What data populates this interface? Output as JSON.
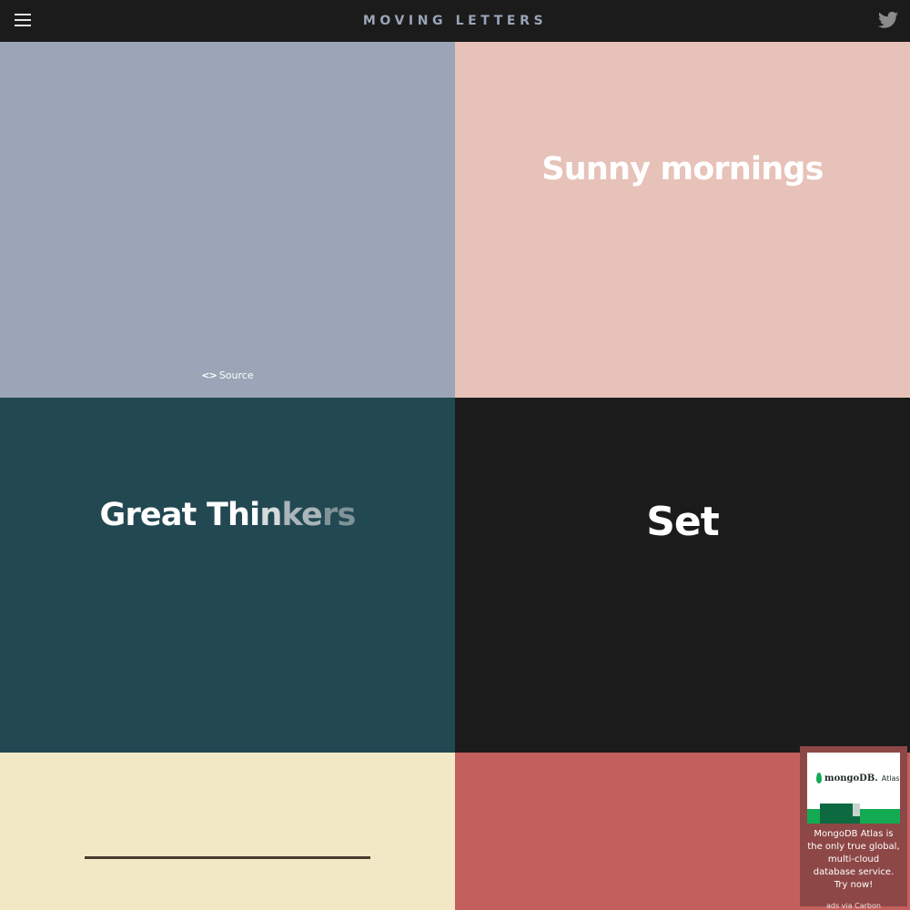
{
  "header": {
    "title": "MOVING LETTERS",
    "menu_icon": "hamburger-icon",
    "social_icon": "twitter-icon"
  },
  "tiles": {
    "source_label": "Source",
    "source_icon": "code-icon",
    "sunny": "Sunny mornings",
    "great": {
      "solid": "Great Thi",
      "fade1": "n",
      "fade2": "ke",
      "fade3": "rs"
    },
    "set": "Set"
  },
  "ad": {
    "brand": "mongoDB.",
    "product": "Atlas",
    "text": "MongoDB Atlas is the only true global, multi-cloud database service. Try now!",
    "via": "ads via Carbon"
  },
  "colors": {
    "header_bg": "#1b1b1b",
    "tile_1": "#9ba5b7",
    "tile_2": "#e7c2b8",
    "tile_3": "#224852",
    "tile_4": "#1b1b1b",
    "tile_5": "#f3e8c6",
    "tile_6": "#c3605d",
    "ad_bg": "#8d4746",
    "mongodb_green": "#13aa52"
  }
}
